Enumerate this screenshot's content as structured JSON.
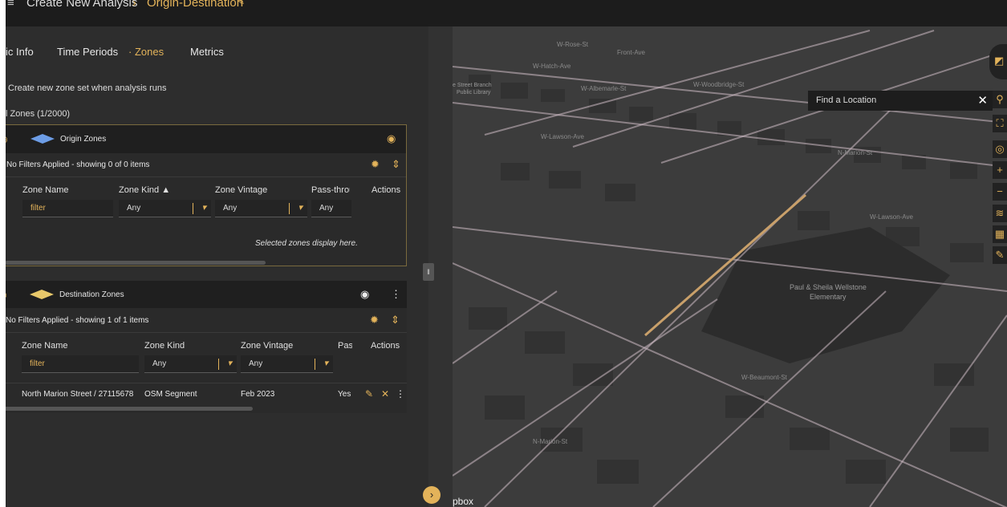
{
  "breadcrumb": {
    "root": "Create New Analysis",
    "current": "Origin-Destination"
  },
  "tabs": [
    {
      "label": "ic Info"
    },
    {
      "label": "Time Periods"
    },
    {
      "label": "· Zones"
    },
    {
      "label": "Metrics"
    }
  ],
  "options": {
    "create_zone_set_label": "Create new zone set when analysis runs"
  },
  "zones_count_label": "l Zones (1/2000)",
  "origin": {
    "title": "Origin Zones",
    "filter_summary": "No Filters Applied - showing 0 of 0 items",
    "columns": [
      "Zone Name",
      "Zone Kind ▲",
      "Zone Vintage",
      "Pass-throu",
      "Actions"
    ],
    "filter_placeholder": "filter",
    "kind_value": "Any",
    "vintage_value": "Any",
    "pass_value": "Any",
    "empty_message": "Selected zones display here."
  },
  "destination": {
    "title": "Destination Zones",
    "filter_summary": "No Filters Applied - showing 1 of 1 items",
    "columns": [
      "Zone Name",
      "Zone Kind",
      "Zone Vintage",
      "Pas",
      "Actions"
    ],
    "filter_placeholder": "filter",
    "kind_value": "Any",
    "vintage_value": "Any",
    "row": {
      "zone_name": "North Marion Street / 27115678",
      "zone_kind": "OSM Segment",
      "zone_vintage": "Feb 2023",
      "pass_through": "Yes"
    }
  },
  "map": {
    "find_location_placeholder": "Find a Location",
    "attribution": "pbox",
    "school_label_line1": "Paul & Sheila Wellstone",
    "school_label_line2": "Elementary",
    "library_label_line1": "e Street Branch",
    "library_label_line2": "Public Library",
    "streets": [
      "N-Marion-St",
      "Front-Ave",
      "W-Hatch-Ave",
      "W-Albemarle-St",
      "W-Woodbridge-St",
      "W-Lawson-Ave",
      "W-Rose-St",
      "W-Beaumont-St"
    ]
  },
  "colors": {
    "accent": "#e3b35a",
    "origin_diamond": "#6d9de6",
    "destination_diamond": "#e8c86a",
    "selected_segment": "#c9a06a"
  }
}
